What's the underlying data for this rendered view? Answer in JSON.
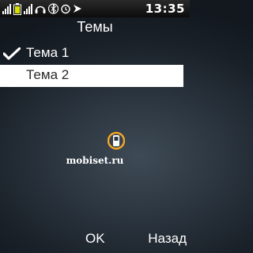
{
  "status_bar": {
    "time": "13:35",
    "icons": [
      "signal-bars-icon",
      "battery-icon",
      "network-bars-icon",
      "headset-icon",
      "bluetooth-icon",
      "alarm-icon",
      "nav-arrow-icon"
    ]
  },
  "screen": {
    "title": "Темы"
  },
  "themes": [
    {
      "label": "Тема 1",
      "checked": true
    },
    {
      "label": "Тема 2",
      "checked": false
    }
  ],
  "softkeys": {
    "left": "OK",
    "right": "Назад"
  },
  "watermark": {
    "text": "mobiset.ru"
  },
  "colors": {
    "selection": "#ffffff",
    "check": "#ffffff",
    "logo_orange": "#f5a623"
  }
}
